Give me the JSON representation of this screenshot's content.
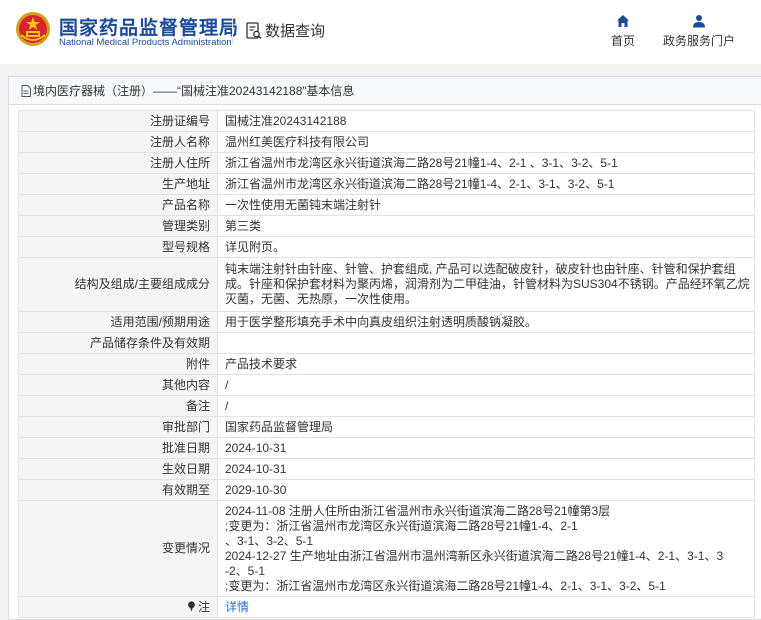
{
  "header": {
    "brand_cn": "国家药品监督管理局",
    "brand_en": "National Medical Products Administration",
    "data_query": "数据查询",
    "nav": {
      "home": "首页",
      "portal": "政务服务门户"
    }
  },
  "panel": {
    "title": "境内医疗器械（注册）——“国械注准20243142188”基本信息"
  },
  "rows": [
    {
      "label": "注册证编号",
      "value": "国械注准20243142188"
    },
    {
      "label": "注册人名称",
      "value": "温州红美医疗科技有限公司"
    },
    {
      "label": "注册人住所",
      "value": "浙江省温州市龙湾区永兴街道滨海二路28号21幢1-4、2-1 、3-1、3-2、5-1"
    },
    {
      "label": "生产地址",
      "value": "浙江省温州市龙湾区永兴街道滨海二路28号21幢1-4、2-1、3-1、3-2、5-1"
    },
    {
      "label": "产品名称",
      "value": "一次性使用无菌钝末端注射针"
    },
    {
      "label": "管理类别",
      "value": "第三类"
    },
    {
      "label": "型号规格",
      "value": "详见附页。"
    },
    {
      "label": "结构及组成/主要组成成分",
      "value": "钝末端注射针由针座、针管、护套组成, 产品可以选配破皮针，破皮针也由针座、针管和保护套组成。针座和保护套材料为聚丙烯，润滑剂为二甲硅油，针管材料为SUS304不锈钢。产品经环氧乙烷灭菌，无菌、无热原，一次性使用。"
    },
    {
      "label": "适用范围/预期用途",
      "value": "用于医学整形填充手术中向真皮组织注射透明质酸钠凝胶。"
    },
    {
      "label": "产品储存条件及有效期",
      "value": ""
    },
    {
      "label": "附件",
      "value": "产品技术要求"
    },
    {
      "label": "其他内容",
      "value": "/"
    },
    {
      "label": "备注",
      "value": "/"
    },
    {
      "label": "审批部门",
      "value": "国家药品监督管理局"
    },
    {
      "label": "批准日期",
      "value": "2024-10-31"
    },
    {
      "label": "生效日期",
      "value": "2024-10-31"
    },
    {
      "label": "有效期至",
      "value": "2029-10-30"
    }
  ],
  "change": {
    "label": "变更情况",
    "lines": [
      "2024-11-08 注册人住所由浙江省温州市永兴街道滨海二路28号21幢第3层",
      ";变更为：浙江省温州市龙湾区永兴街道滨海二路28号21幢1-4、2-1",
      "、3-1、3-2、5-1",
      "2024-12-27 生产地址由浙江省温州市温州湾新区永兴街道滨海二路28号21幢1-4、2-1、3-1、3",
      "-2、5-1",
      ";变更为：浙江省温州市龙湾区永兴街道滨海二路28号21幢1-4、2-1、3-1、3-2、5-1"
    ]
  },
  "note": {
    "label": "注",
    "link": "详情"
  },
  "icons": {
    "emblem": "national-emblem-icon",
    "data_query": "document-search-icon",
    "home": "home-icon",
    "portal": "user-icon",
    "title": "document-icon",
    "note": "pin-icon"
  },
  "colors": {
    "brand": "#1b4a9a",
    "link": "#2b6fcf",
    "label_bg": "#f5f5f5"
  }
}
